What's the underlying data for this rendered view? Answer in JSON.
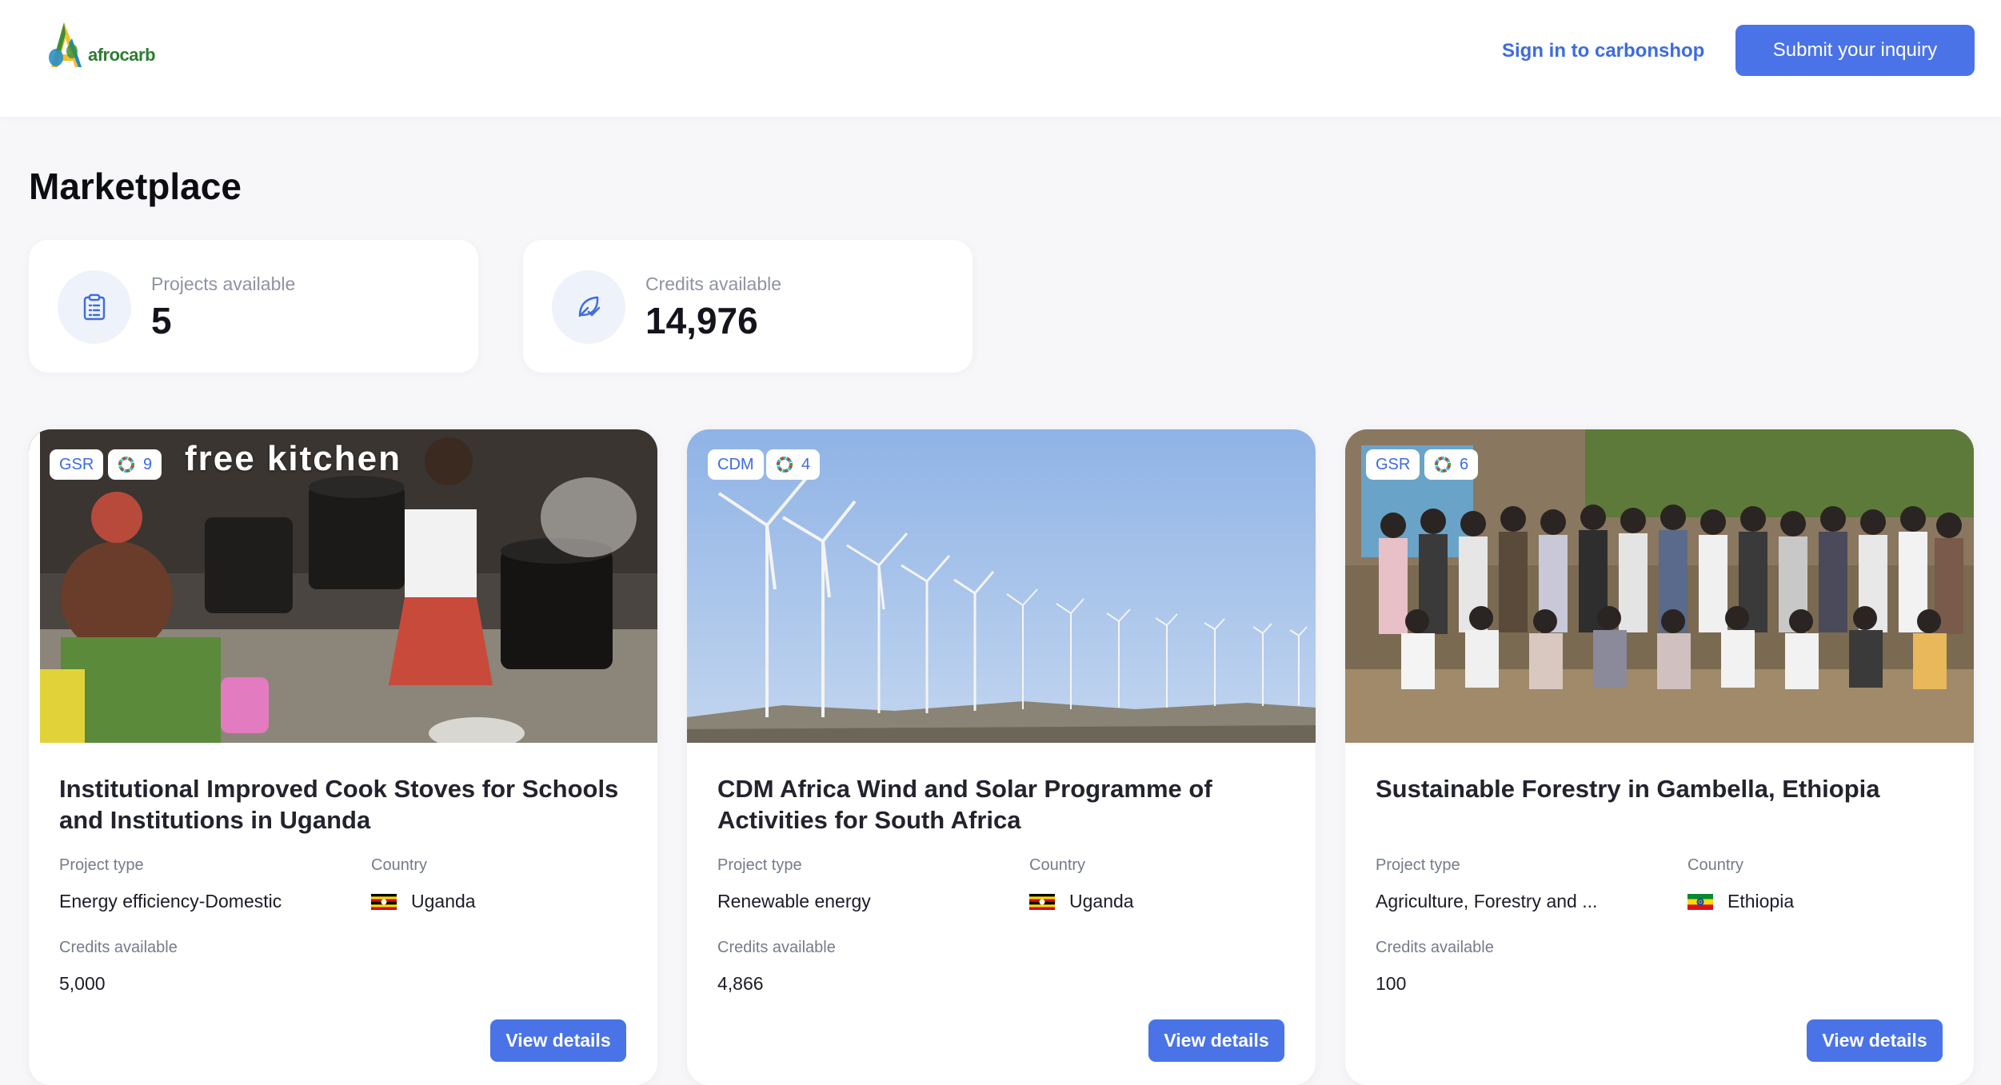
{
  "header": {
    "logo_text": "afrocarb",
    "signin_label": "Sign in to carbonshop",
    "submit_label": "Submit your inquiry"
  },
  "page": {
    "title": "Marketplace"
  },
  "stats": [
    {
      "label": "Projects available",
      "value": "5",
      "icon": "clipboard-icon"
    },
    {
      "label": "Credits available",
      "value": "14,976",
      "icon": "leaf-check-icon"
    }
  ],
  "cards": [
    {
      "standard": "GSR",
      "sdg_count": "9",
      "image_caption": "free kitchen",
      "title": "Institutional Improved Cook Stoves for Schools and Institutions in Uganda",
      "project_type_label": "Project type",
      "project_type": "Energy efficiency-Domestic",
      "country_label": "Country",
      "country": "Uganda",
      "credits_label": "Credits available",
      "credits": "5,000",
      "button_label": "View details"
    },
    {
      "standard": "CDM",
      "sdg_count": "4",
      "title": "CDM Africa Wind and Solar Programme of Activities for South Africa",
      "project_type_label": "Project type",
      "project_type": "Renewable energy",
      "country_label": "Country",
      "country": "Uganda",
      "credits_label": "Credits available",
      "credits": "4,866",
      "button_label": "View details"
    },
    {
      "standard": "GSR",
      "sdg_count": "6",
      "title": "Sustainable Forestry in Gambella, Ethiopia",
      "project_type_label": "Project type",
      "project_type": "Agriculture, Forestry and ...",
      "country_label": "Country",
      "country": "Ethiopia",
      "credits_label": "Credits available",
      "credits": "100",
      "button_label": "View details"
    }
  ],
  "colors": {
    "accent": "#4a73e8",
    "link": "#3d6be0",
    "background": "#f7f7f9"
  }
}
